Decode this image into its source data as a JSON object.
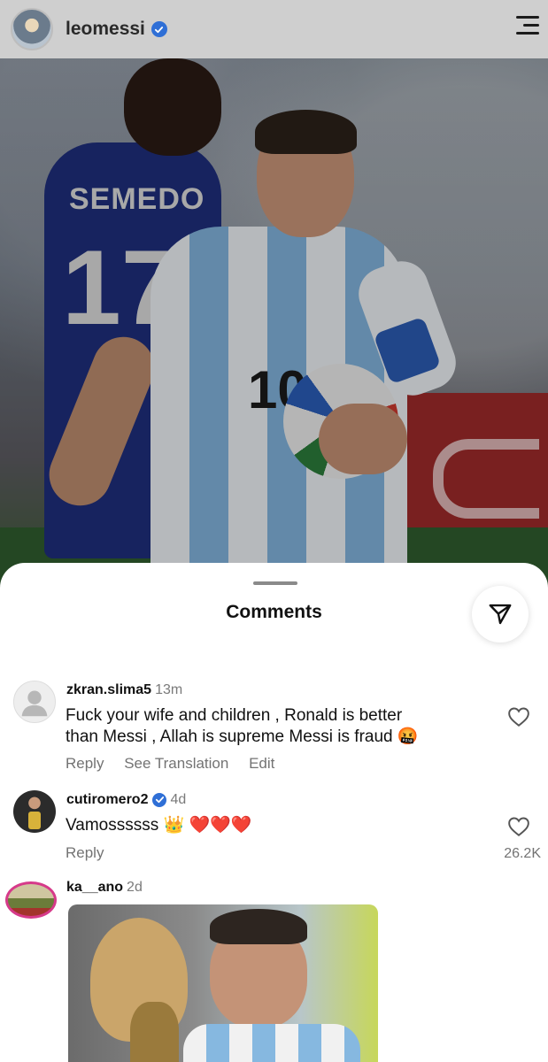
{
  "header": {
    "username": "leomessi",
    "verified": true
  },
  "post": {
    "jersey_back_name": "SEMEDO",
    "jersey_back_number": "17",
    "jersey_front_number": "10"
  },
  "comments_sheet": {
    "title": "Comments",
    "comments": [
      {
        "username": "zkran.slima5",
        "time": "13m",
        "text_line1": "Fuck your wife and children , Ronald is better",
        "text_line2": "than Messi , Allah is supreme Messi is fraud 🤬",
        "actions": [
          "Reply",
          "See Translation",
          "Edit"
        ],
        "likes": ""
      },
      {
        "username": "cutiromero2",
        "verified": true,
        "time": "4d",
        "text": "Vamossssss 👑 ❤️❤️❤️",
        "actions": [
          "Reply"
        ],
        "likes": "26.2K"
      },
      {
        "username": "ka__ano",
        "time": "2d",
        "text": "",
        "actions": [],
        "likes": ""
      }
    ]
  },
  "colors": {
    "verified_blue": "#2f6fd6",
    "meta_gray": "#737373"
  },
  "icons": [
    "verified-badge-icon",
    "hamburger-menu-icon",
    "share-icon",
    "heart-icon",
    "default-avatar-icon"
  ]
}
